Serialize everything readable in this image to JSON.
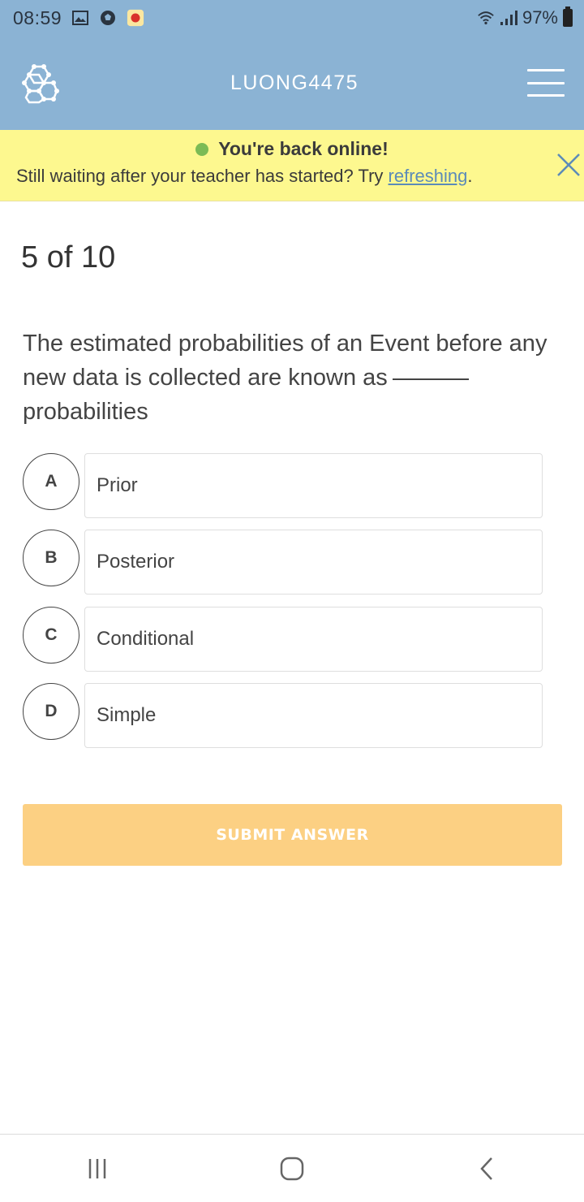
{
  "status_bar": {
    "time": "08:59",
    "battery": "97%",
    "icons": [
      "gallery-icon",
      "soccer-ball-icon",
      "app-notification-icon",
      "wifi-icon",
      "signal-icon",
      "battery-icon"
    ]
  },
  "header": {
    "title": "LUONG4475",
    "logo_icon": "molecule-logo-icon",
    "menu_icon": "hamburger-menu-icon"
  },
  "banner": {
    "heading": "You're back online!",
    "message": "Still waiting after your teacher has started? Try ",
    "link": "refreshing",
    "suffix": "."
  },
  "quiz": {
    "progress": "5 of 10",
    "question_part1": "The estimated probabilities of an Event before any new data is collected are known as",
    "question_part2": "probabilities",
    "options": [
      {
        "letter": "A",
        "text": "Prior"
      },
      {
        "letter": "B",
        "text": "Posterior"
      },
      {
        "letter": "C",
        "text": "Conditional"
      },
      {
        "letter": "D",
        "text": "Simple"
      }
    ],
    "submit_label": "SUBMIT ANSWER"
  },
  "colors": {
    "header": "#8bb3d4",
    "banner": "#fdf88f",
    "online_dot": "#7cbb55",
    "link": "#5c8bb8",
    "submit": "#fcd083"
  },
  "nav": {
    "icons": [
      "recent-apps-icon",
      "home-icon",
      "back-icon"
    ]
  }
}
